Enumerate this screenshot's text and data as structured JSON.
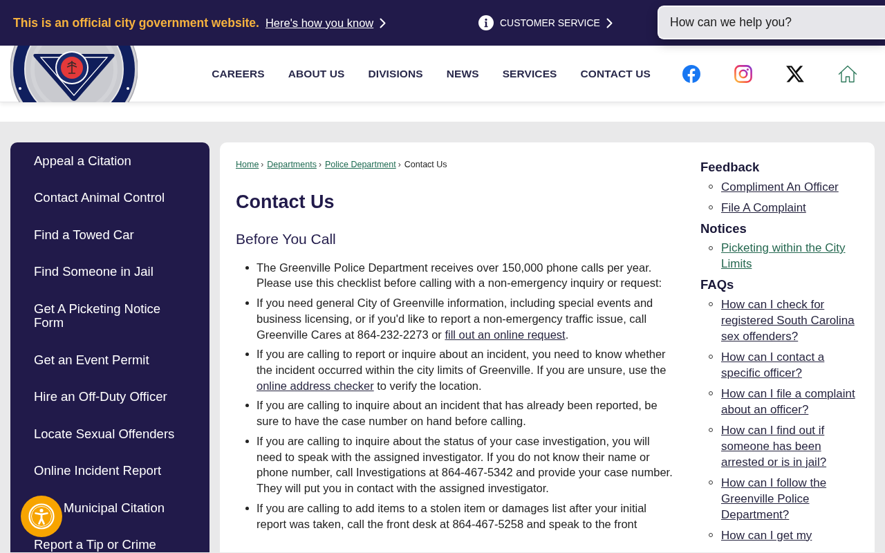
{
  "banner": {
    "notice": "This is an official city government website.",
    "how_you_know_link": "Here's how you know",
    "customer_service": "CUSTOMER SERVICE",
    "search": {
      "placeholder": "How can we help you?"
    }
  },
  "nav": {
    "items": [
      "CAREERS",
      "ABOUT US",
      "DIVISIONS",
      "NEWS",
      "SERVICES",
      "CONTACT US"
    ]
  },
  "sidebar": {
    "items": [
      "Appeal a Citation",
      "Contact Animal Control",
      "Find a Towed Car",
      "Find Someone in Jail",
      "Get A Picketing Notice Form",
      "Get an Event Permit",
      "Hire an Off-Duty Officer",
      "Locate Sexual Offenders",
      "Online Incident Report",
      "Municipal Citation",
      "Report a Tip or Crime"
    ]
  },
  "breadcrumbs": [
    {
      "label": "Home",
      "current": false,
      "separator": "›"
    },
    {
      "label": "Departments",
      "current": false,
      "separator": "›"
    },
    {
      "label": "Police Department",
      "current": false,
      "separator": "›"
    },
    {
      "label": "Contact Us",
      "current": true
    }
  ],
  "page_title": "Contact Us",
  "section_heading": "Before You Call",
  "bullets": [
    {
      "parts": [
        {
          "kind": "text",
          "text": "The Greenville Police Department receives over 150,000 phone calls per year. Please use this checklist before calling with a non-emergency inquiry or request:"
        }
      ]
    },
    {
      "parts": [
        {
          "kind": "text",
          "text": "If you need general City of Greenville information, including special events and business licensing, or if you'd like to report a non-emergency traffic issue, call Greenville Cares at 864-232-2273 or "
        },
        {
          "kind": "link",
          "text": "fill out an online request"
        },
        {
          "kind": "text",
          "text": "."
        }
      ]
    },
    {
      "parts": [
        {
          "kind": "text",
          "text": "If you are calling to report or inquire about an incident, you need to know whether the incident occurred within the city limits of Greenville. If you are unsure, use the "
        },
        {
          "kind": "link",
          "text": "online address checker"
        },
        {
          "kind": "text",
          "text": " to verify the location."
        }
      ]
    },
    {
      "parts": [
        {
          "kind": "text",
          "text": "If you are calling to inquire about an incident that has already been reported, be sure to have the case number on hand before calling."
        }
      ]
    },
    {
      "parts": [
        {
          "kind": "text",
          "text": "If you are calling to inquire about the status of your case investigation, you will need to speak with the assigned investigator. If you do not know their name or phone number, call Investigations at 864-467-5342 and provide your case number. They will put you in contact with the assigned investigator."
        }
      ]
    },
    {
      "parts": [
        {
          "kind": "text",
          "text": "If you are calling to add items to a stolen item or damages list after your initial report was taken, call the front desk at 864-467-5258 and speak to the front"
        }
      ]
    }
  ],
  "related": [
    {
      "heading": "Feedback",
      "links": [
        {
          "label": "Compliment An Officer",
          "color": "#26243f"
        },
        {
          "label": "File A Complaint",
          "color": "#26243f"
        }
      ]
    },
    {
      "heading": "Notices",
      "links": [
        {
          "label": "Picketing within the City Limits",
          "color": "#24674f"
        }
      ]
    },
    {
      "heading": "FAQs",
      "links": [
        {
          "label": "How can I check for registered South Carolina sex offenders?",
          "color": "#26243f"
        },
        {
          "label": "How can I contact a specific officer?",
          "color": "#26243f"
        },
        {
          "label": "How can I file a complaint about an officer?",
          "color": "#26243f"
        },
        {
          "label": "How can I find out if someone has been arrested or is in jail?",
          "color": "#26243f"
        },
        {
          "label": "How can I follow the Greenville Police Department?",
          "color": "#26243f"
        },
        {
          "label": "How can I get my",
          "color": "#26243f"
        }
      ]
    }
  ]
}
